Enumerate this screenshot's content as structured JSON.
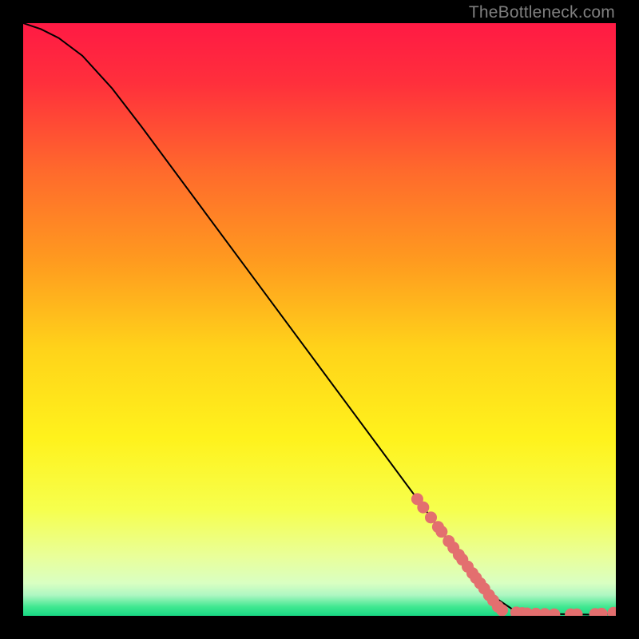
{
  "watermark": "TheBottleneck.com",
  "colors": {
    "line": "#000000",
    "marker_fill": "#e36f6f",
    "marker_stroke": "#d85a5a",
    "gradient_stops": [
      {
        "offset": 0.0,
        "color": "#ff1a44"
      },
      {
        "offset": 0.1,
        "color": "#ff2f3c"
      },
      {
        "offset": 0.25,
        "color": "#ff6a2c"
      },
      {
        "offset": 0.4,
        "color": "#ff9a1f"
      },
      {
        "offset": 0.55,
        "color": "#ffd31a"
      },
      {
        "offset": 0.7,
        "color": "#fff21c"
      },
      {
        "offset": 0.82,
        "color": "#f6ff4d"
      },
      {
        "offset": 0.9,
        "color": "#e9ff9a"
      },
      {
        "offset": 0.945,
        "color": "#d9ffc2"
      },
      {
        "offset": 0.965,
        "color": "#aef7c2"
      },
      {
        "offset": 0.985,
        "color": "#3fe890"
      },
      {
        "offset": 1.0,
        "color": "#18d884"
      }
    ]
  },
  "chart_data": {
    "type": "line",
    "title": "",
    "xlabel": "",
    "ylabel": "",
    "xlim": [
      0,
      100
    ],
    "ylim": [
      0,
      100
    ],
    "series": [
      {
        "name": "curve",
        "x": [
          0,
          3,
          6,
          10,
          15,
          20,
          30,
          40,
          50,
          60,
          70,
          78,
          83,
          87,
          90,
          93,
          96,
          98,
          100
        ],
        "y": [
          100,
          99,
          97.5,
          94.5,
          89,
          82.5,
          69,
          55.5,
          42,
          28.5,
          15,
          4.2,
          0.8,
          0.4,
          0.3,
          0.25,
          0.2,
          0.25,
          0.5
        ]
      }
    ],
    "markers": {
      "name": "highlighted-points",
      "x": [
        66.5,
        67.5,
        68.8,
        70.0,
        70.6,
        71.8,
        72.6,
        73.5,
        74.1,
        75.0,
        75.8,
        76.4,
        77.1,
        77.8,
        78.6,
        79.3,
        80.1,
        80.8,
        83.2,
        84.2,
        85.0,
        86.5,
        88.0,
        89.6,
        92.4,
        93.4,
        96.5,
        97.6,
        99.6
      ],
      "y": [
        19.7,
        18.3,
        16.6,
        15.0,
        14.2,
        12.6,
        11.5,
        10.3,
        9.5,
        8.3,
        7.2,
        6.4,
        5.5,
        4.6,
        3.5,
        2.6,
        1.55,
        0.95,
        0.55,
        0.45,
        0.4,
        0.35,
        0.3,
        0.25,
        0.25,
        0.25,
        0.3,
        0.35,
        0.5
      ]
    }
  }
}
